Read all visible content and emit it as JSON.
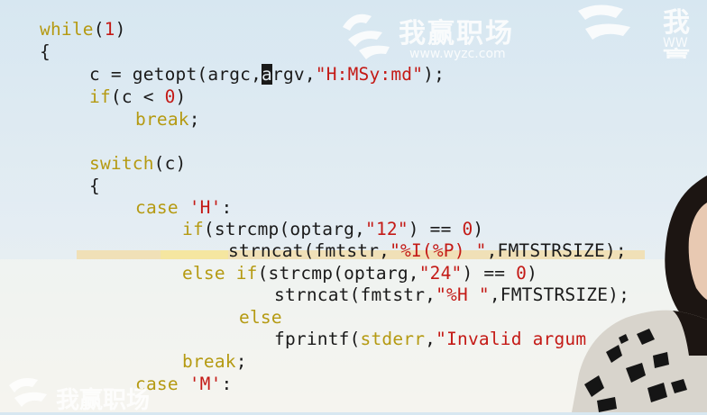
{
  "code_lines": [
    "while(1)",
    "{",
    "    c = getopt(argc,argv,\"H:MSy:md\");",
    "    if(c < 0)",
    "        break;",
    "",
    "    switch(c)",
    "    {",
    "        case 'H':",
    "            if(strcmp(optarg,\"12\") == 0)",
    "                strncat(fmtstr,\"%I(%P) \",FMTSTRSIZE);",
    "            else if(strcmp(optarg,\"24\") == 0)",
    "                strncat(fmtstr,\"%H \",FMTSTRSIZE);",
    "                  else",
    "                    fprintf(stderr,\"Invalid argum",
    "            break;",
    "        case 'M':"
  ],
  "watermark": {
    "brand": "我赢职场",
    "url": "www.wyzc.com",
    "corner_brand": "我赢职场",
    "corner_url": "WW"
  },
  "colors": {
    "keyword": "#b59a12",
    "string": "#c41a16",
    "text": "#1a1a1a"
  }
}
